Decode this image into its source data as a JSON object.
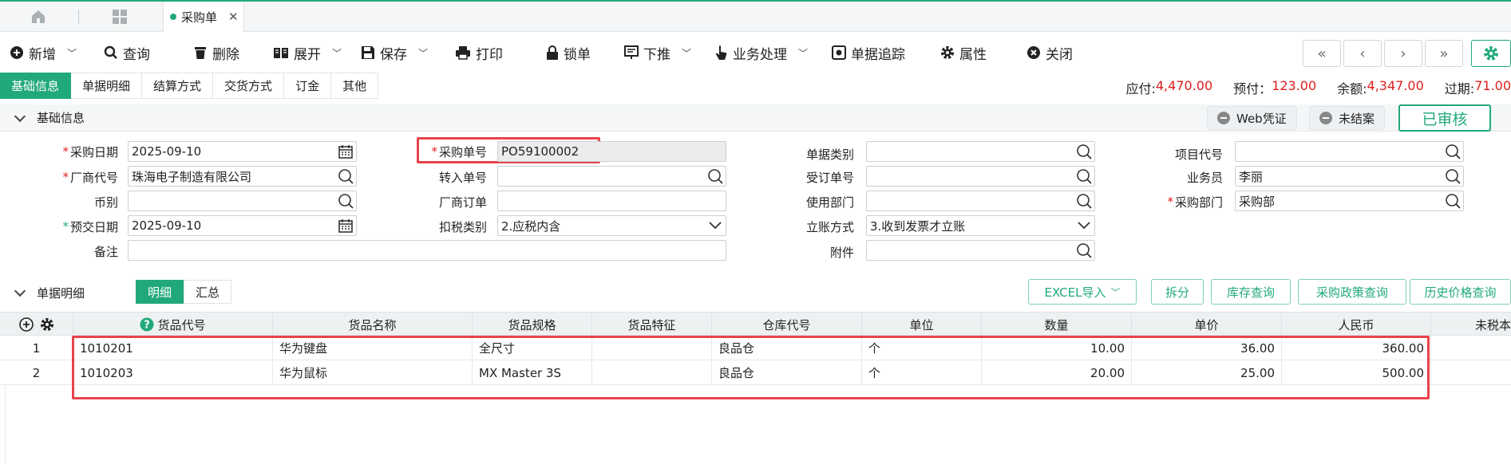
{
  "tabbar": {
    "doc_tab": "采购单",
    "home_icon": "home-icon",
    "apps_icon": "grid-apps-icon"
  },
  "toolbar": {
    "new": "新增",
    "query": "查询",
    "delete": "删除",
    "expand": "展开",
    "save": "保存",
    "print": "打印",
    "lock": "锁单",
    "push": "下推",
    "business": "业务处理",
    "trace": "单据追踪",
    "props": "属性",
    "close": "关闭"
  },
  "tabs": [
    "基础信息",
    "单据明细",
    "结算方式",
    "交货方式",
    "订金",
    "其他"
  ],
  "summary": {
    "payable_label": "应付:",
    "payable": "4,470.00",
    "prepaid_label": "预付：",
    "prepaid": "123.00",
    "balance_label": "余额:",
    "balance": "4,347.00",
    "overdue_label": "过期:",
    "overdue": "71.00"
  },
  "basic_section": {
    "title": "基础信息",
    "web_voucher": "Web凭证",
    "not_closed": "未结案",
    "status": "已审核"
  },
  "form": {
    "purchase_date_label": "采购日期",
    "purchase_date": "2025-09-10",
    "vendor_code_label": "厂商代号",
    "vendor_code": "珠海电子制造有限公司",
    "currency_label": "币别",
    "currency": "",
    "delivery_date_label": "预交日期",
    "delivery_date": "2025-09-10",
    "remark_label": "备注",
    "remark": "",
    "po_no_label": "采购单号",
    "po_no": "PO59100002",
    "transfer_no_label": "转入单号",
    "transfer_no": "",
    "vendor_order_label": "厂商订单",
    "vendor_order": "",
    "tax_type_label": "扣税类别",
    "tax_type": "2.应税内含",
    "doc_type_label": "单据类别",
    "doc_type": "",
    "order_no_label": "受订单号",
    "order_no": "",
    "use_dept_label": "使用部门",
    "use_dept": "",
    "account_method_label": "立账方式",
    "account_method": "3.收到发票才立账",
    "attachment_label": "附件",
    "attachment": "",
    "project_code_label": "项目代号",
    "project_code": "",
    "salesman_label": "业务员",
    "salesman": "李丽",
    "purchase_dept_label": "采购部门",
    "purchase_dept": "采购部"
  },
  "detail_section": {
    "title": "单据明细",
    "tab_detail": "明细",
    "tab_summary": "汇总",
    "excel_import": "EXCEL导入",
    "split": "拆分",
    "stock_query": "库存查询",
    "policy_query": "采购政策查询",
    "price_history": "历史价格查询"
  },
  "grid": {
    "columns": [
      "货品代号",
      "货品名称",
      "货品规格",
      "货品特征",
      "仓库代号",
      "单位",
      "数量",
      "单价",
      "人民币",
      "未税本"
    ],
    "rows": [
      {
        "no": "1",
        "code": "1010201",
        "name": "华为键盘",
        "spec": "全尺寸",
        "feature": "",
        "warehouse": "良品仓",
        "unit": "个",
        "qty": "10.00",
        "price": "36.00",
        "rmb": "360.00"
      },
      {
        "no": "2",
        "code": "1010203",
        "name": "华为鼠标",
        "spec": "MX Master 3S",
        "feature": "",
        "warehouse": "良品仓",
        "unit": "个",
        "qty": "20.00",
        "price": "25.00",
        "rmb": "500.00"
      }
    ]
  }
}
